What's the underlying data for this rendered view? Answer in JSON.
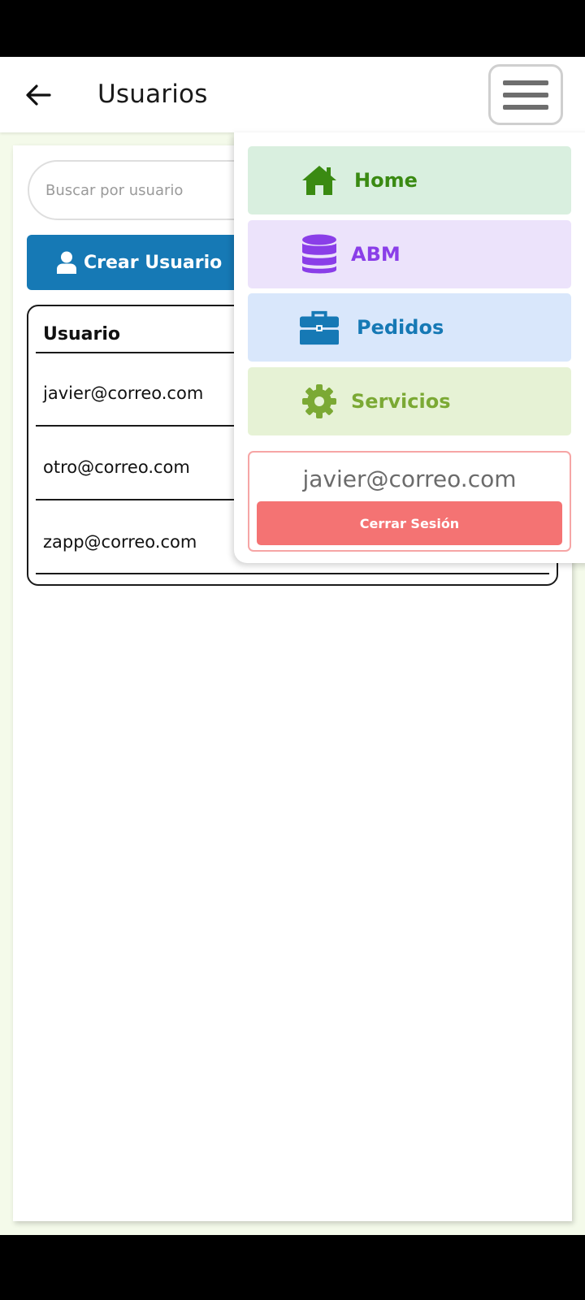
{
  "header": {
    "title": "Usuarios",
    "back_icon": "arrow-left-icon",
    "menu_icon": "hamburger-icon"
  },
  "search": {
    "placeholder": "Buscar por usuario",
    "value": ""
  },
  "create_button": {
    "label": "Crear Usuario",
    "icon": "user-icon",
    "color": "#1679b5"
  },
  "table": {
    "header": "Usuario",
    "rows": [
      "javier@correo.com",
      "otro@correo.com",
      "zapp@correo.com"
    ]
  },
  "menu": {
    "items": [
      {
        "label": "Home",
        "icon": "home-icon",
        "bg": "#d9efdf",
        "fg": "#3a8a12"
      },
      {
        "label": "ABM",
        "icon": "database-icon",
        "bg": "#ece3fb",
        "fg": "#8a3ee8"
      },
      {
        "label": "Pedidos",
        "icon": "briefcase-icon",
        "bg": "#d9e7fb",
        "fg": "#1679b5"
      },
      {
        "label": "Servicios",
        "icon": "gear-icon",
        "bg": "#e6f2d5",
        "fg": "#7ba934"
      }
    ],
    "user_email": "javier@correo.com",
    "logout_label": "Cerrar Sesión",
    "logout_color": "#f47373"
  }
}
